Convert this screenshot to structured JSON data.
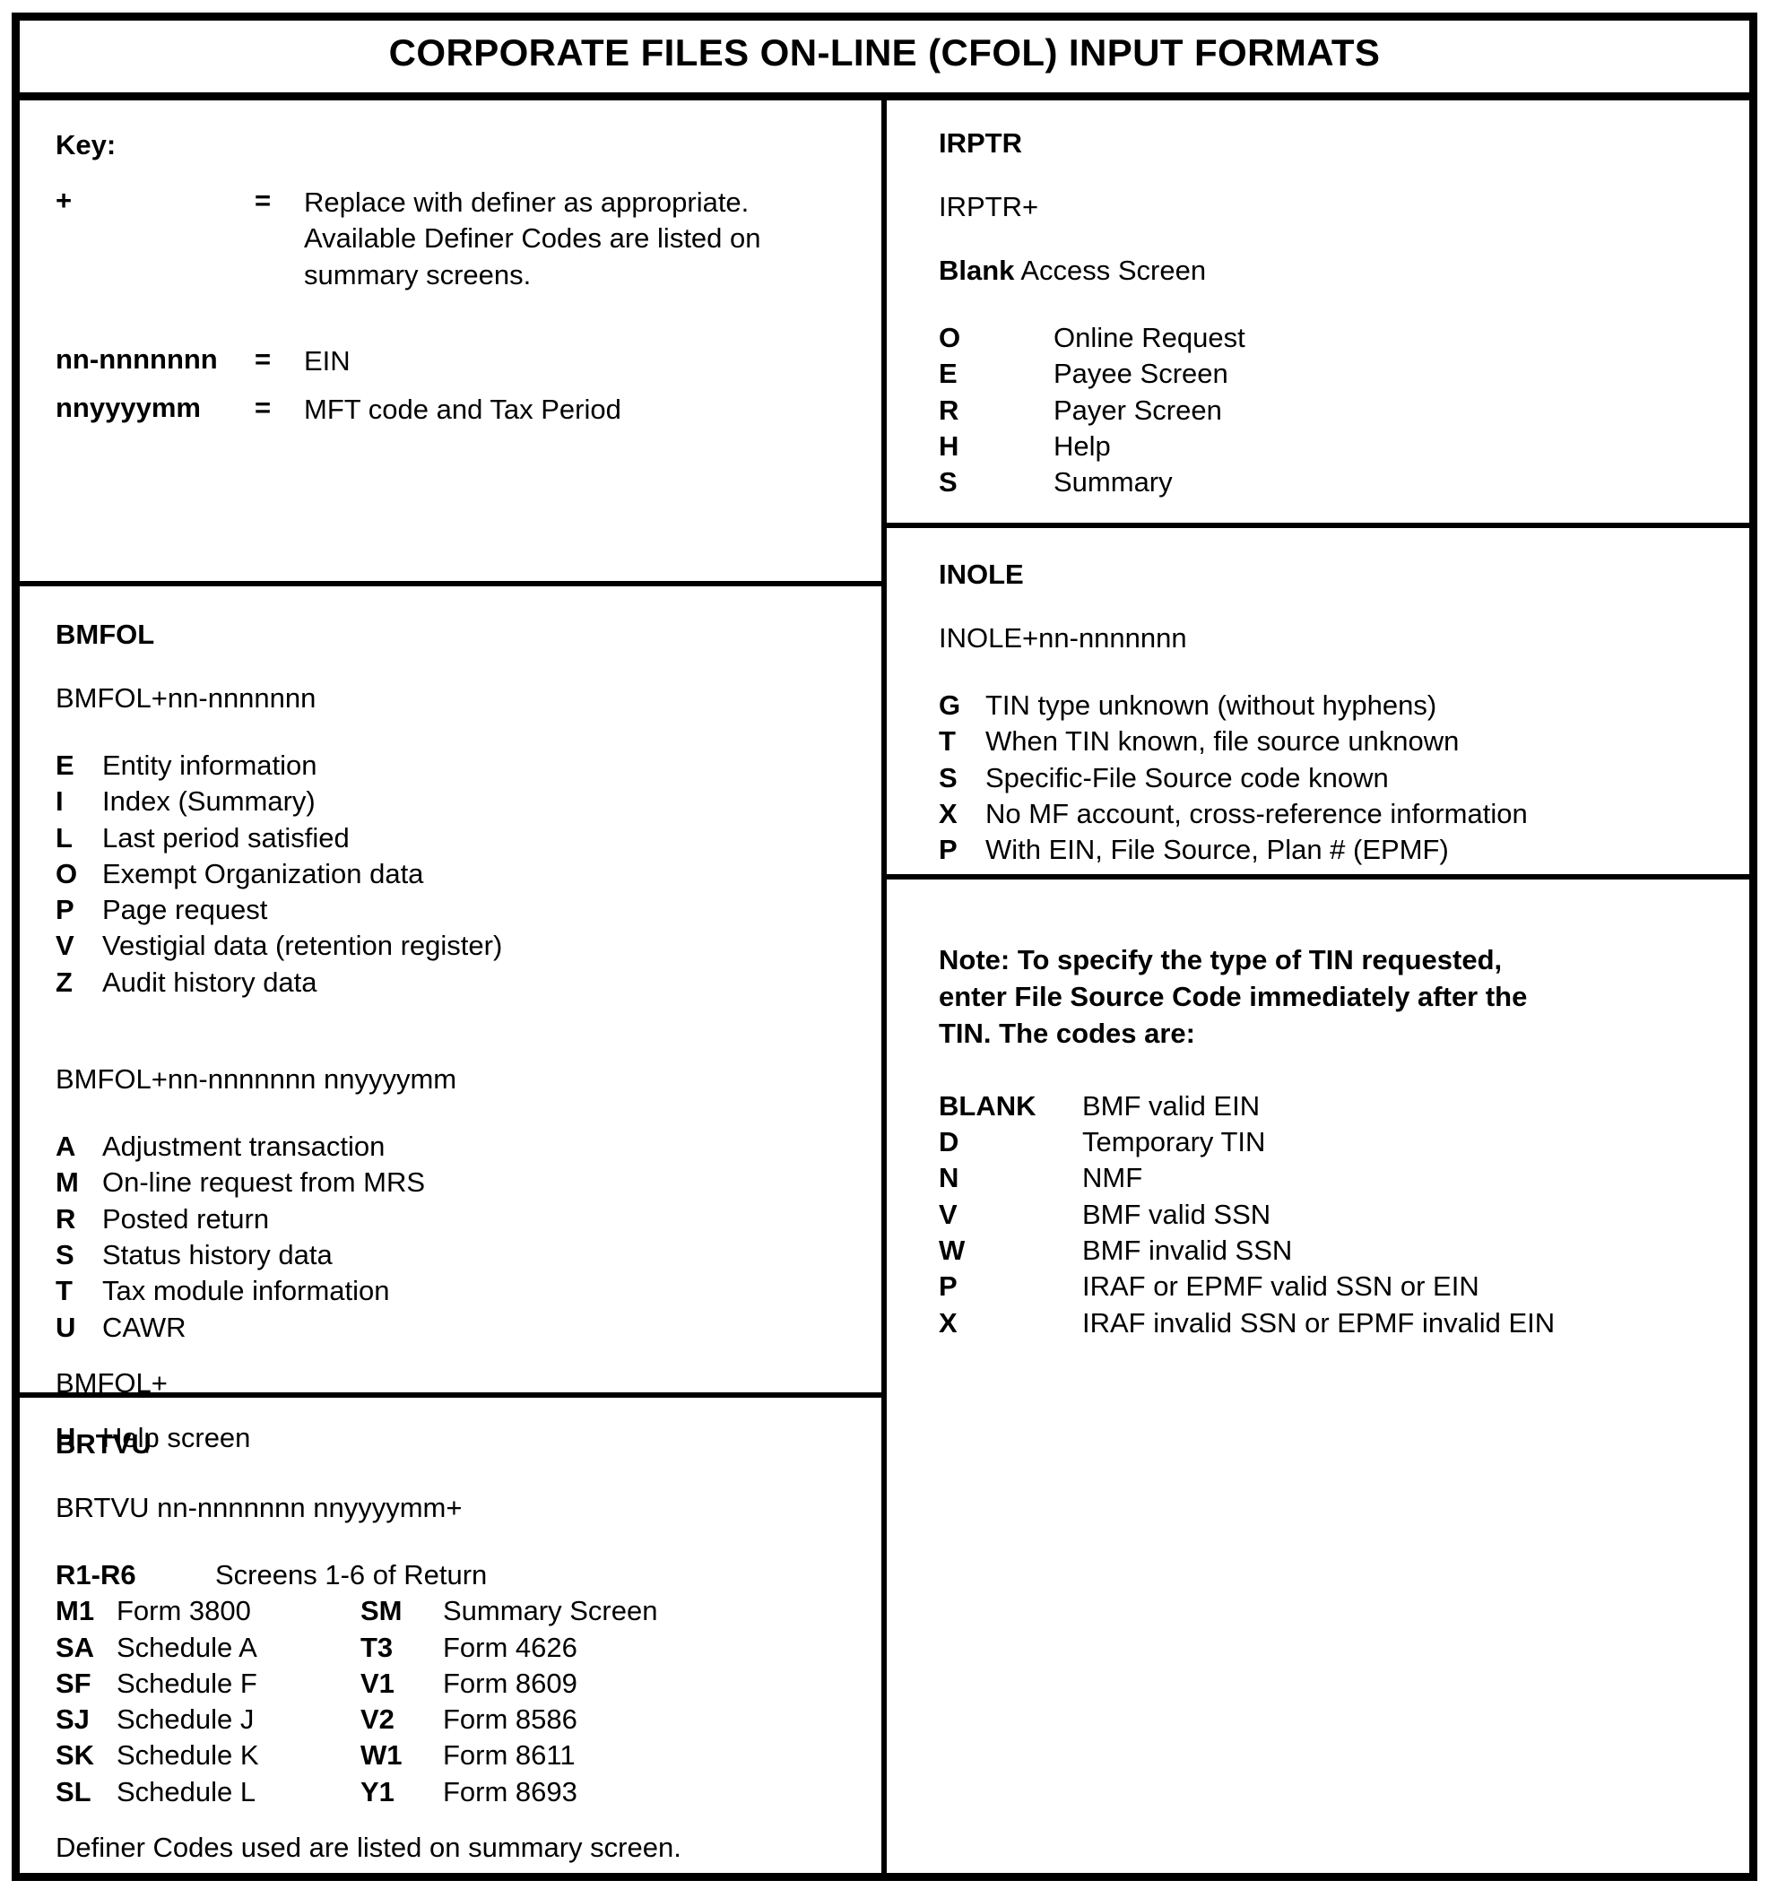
{
  "document": {
    "title": "CORPORATE FILES ON-LINE (CFOL) INPUT FORMATS"
  },
  "key_section": {
    "heading": "Key:",
    "rows": [
      {
        "symbol": "+",
        "equals": "=",
        "definition": "Replace with definer as appropriate. Available Definer Codes are listed on summary screens."
      },
      {
        "symbol": "nn-nnnnnnn",
        "equals": "=",
        "definition": "EIN"
      },
      {
        "symbol": "nnyyyymm",
        "equals": "=",
        "definition": "MFT code and Tax Period"
      }
    ]
  },
  "bmfol": {
    "heading": "BMFOL",
    "format_1": "BMFOL+nn-nnnnnnn",
    "codes_1": [
      {
        "code": "E",
        "desc": "Entity information"
      },
      {
        "code": "I",
        "desc": "Index (Summary)"
      },
      {
        "code": "L",
        "desc": " Last period satisfied"
      },
      {
        "code": "O",
        "desc": "Exempt Organization data"
      },
      {
        "code": "P",
        "desc": "Page request"
      },
      {
        "code": "V",
        "desc": "Vestigial data (retention register)"
      },
      {
        "code": "Z",
        "desc": "Audit history data"
      }
    ],
    "format_2": "BMFOL+nn-nnnnnnn nnyyyymm",
    "codes_2": [
      {
        "code": "A",
        "desc": "Adjustment transaction"
      },
      {
        "code": "M",
        "desc": "On-line request from MRS"
      },
      {
        "code": "R",
        "desc": "Posted return"
      },
      {
        "code": "S",
        "desc": "Status history data"
      },
      {
        "code": "T",
        "desc": "Tax module information"
      },
      {
        "code": "U",
        "desc": "CAWR"
      }
    ],
    "format_3": "BMFOL+",
    "codes_3": [
      {
        "code": "H",
        "desc": "Help screen"
      }
    ]
  },
  "brtvu": {
    "heading": "BRTVU",
    "format": "BRTVU nn-nnnnnnn nnyyyymm+",
    "screens_row": {
      "code": "R1-R6",
      "desc": "Screens 1-6 of Return"
    },
    "table": [
      {
        "left_code": "M1",
        "left_desc": "Form 3800",
        "right_code": "SM",
        "right_desc": "Summary Screen"
      },
      {
        "left_code": "SA",
        "left_desc": "Schedule A",
        "right_code": "T3",
        "right_desc": "Form 4626"
      },
      {
        "left_code": "SF",
        "left_desc": "Schedule F",
        "right_code": "V1",
        "right_desc": "Form 8609"
      },
      {
        "left_code": "SJ",
        "left_desc": "Schedule J",
        "right_code": "V2",
        "right_desc": "Form 8586"
      },
      {
        "left_code": "SK",
        "left_desc": "Schedule K",
        "right_code": "W1",
        "right_desc": "Form 8611"
      },
      {
        "left_code": "SL",
        "left_desc": "Schedule L",
        "right_code": "Y1",
        "right_desc": "Form 8693"
      }
    ],
    "footnote": "Definer Codes used are listed on summary screen."
  },
  "irptr": {
    "heading": "IRPTR",
    "format": "IRPTR+",
    "access_bold": "Blank",
    "access_rest": " Access Screen",
    "codes": [
      {
        "code": "O",
        "desc": "Online Request"
      },
      {
        "code": "E",
        "desc": "Payee Screen"
      },
      {
        "code": "R",
        "desc": "Payer Screen"
      },
      {
        "code": "H",
        "desc": "Help"
      },
      {
        "code": "S",
        "desc": "Summary"
      }
    ]
  },
  "inole": {
    "heading": "INOLE",
    "format": "INOLE+nn-nnnnnnn",
    "codes": [
      {
        "code": "G",
        "desc": "TIN type unknown (without hyphens)"
      },
      {
        "code": "T",
        "desc": "When TIN known, file source unknown"
      },
      {
        "code": "S",
        "desc": "Specific-File Source code known"
      },
      {
        "code": "X",
        "desc": "No MF account, cross-reference information"
      },
      {
        "code": "P",
        "desc": "With EIN, File Source, Plan # (EPMF)"
      }
    ]
  },
  "note": {
    "text": "Note:  To specify the type of TIN requested, enter File Source Code immediately after the TIN.  The codes are:",
    "codes": [
      {
        "code": "BLANK",
        "desc": "BMF valid EIN"
      },
      {
        "code": "D",
        "desc": "Temporary TIN"
      },
      {
        "code": "N",
        "desc": "NMF"
      },
      {
        "code": "V",
        "desc": "BMF valid SSN"
      },
      {
        "code": "W",
        "desc": "BMF invalid SSN"
      },
      {
        "code": "P",
        "desc": "IRAF or EPMF valid SSN or EIN"
      },
      {
        "code": "X",
        "desc": "IRAF invalid SSN or EPMF invalid EIN"
      }
    ]
  }
}
